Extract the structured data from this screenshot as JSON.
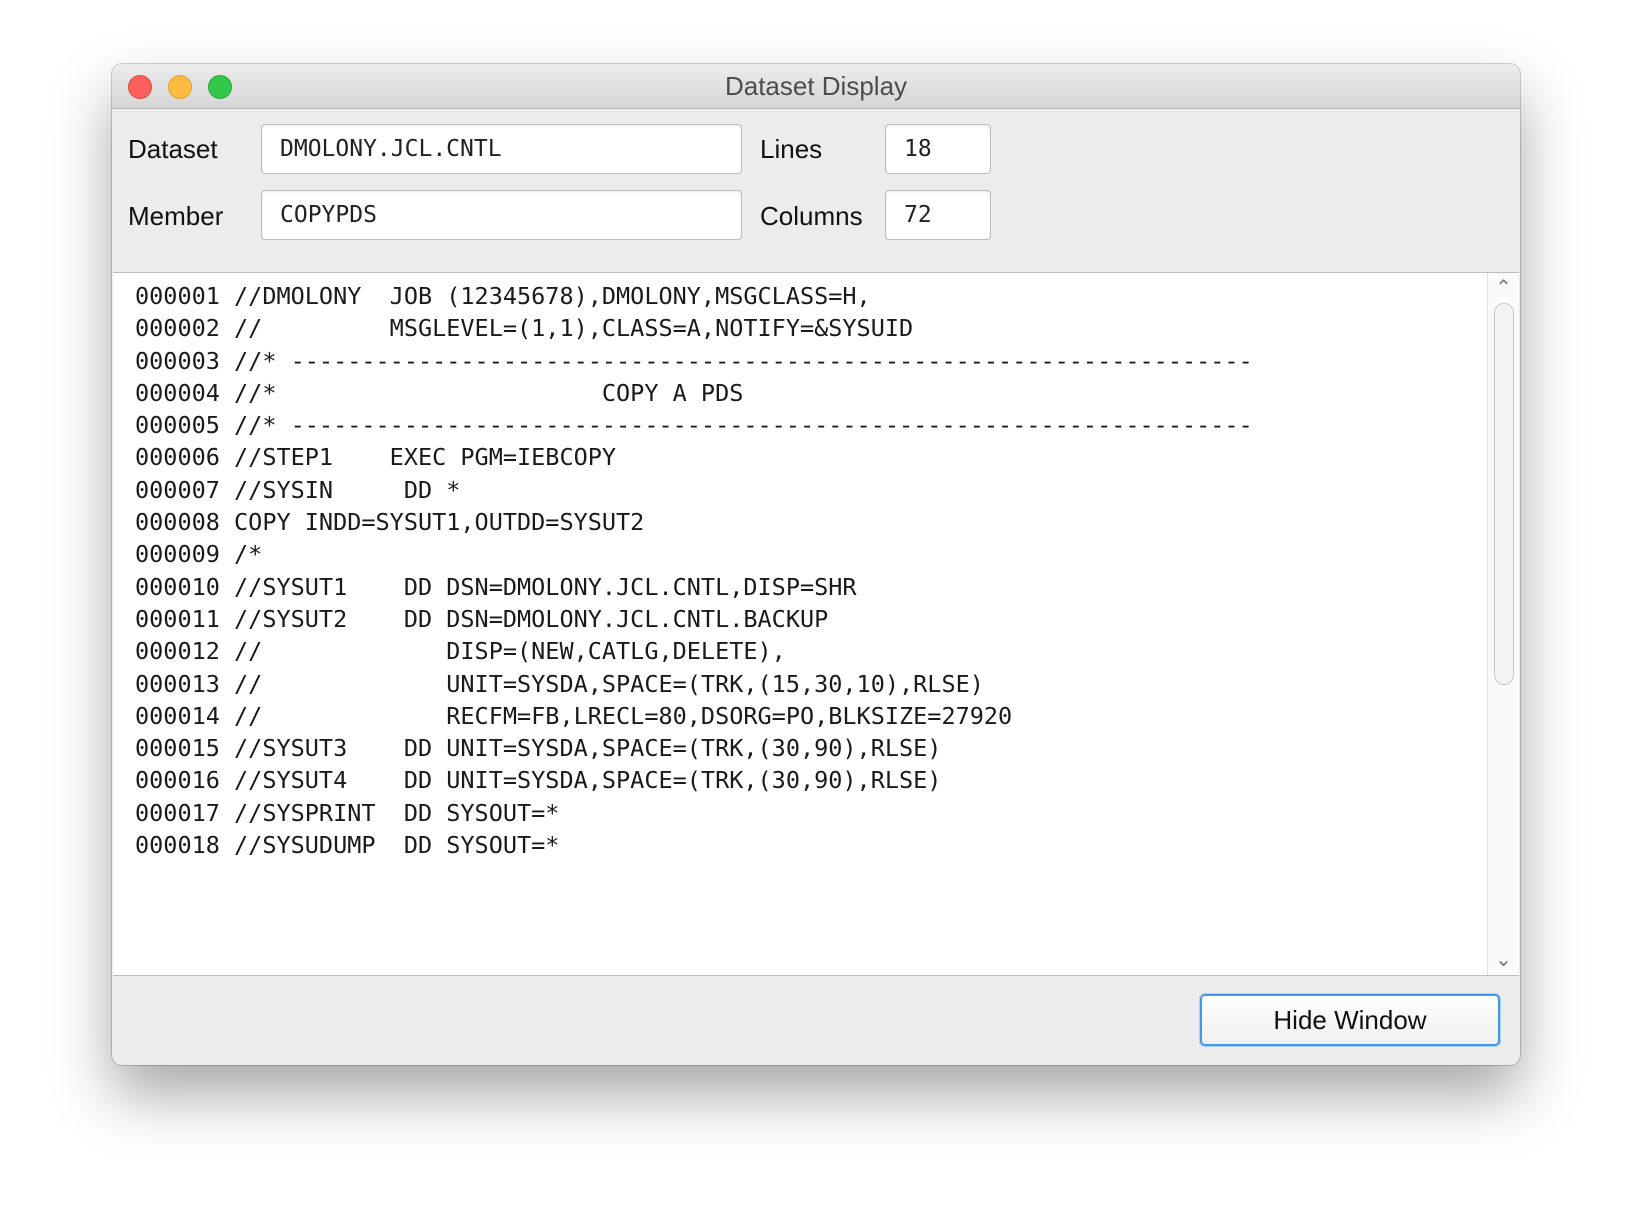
{
  "window": {
    "title": "Dataset Display"
  },
  "form": {
    "dataset_label": "Dataset",
    "dataset_value": "DMOLONY.JCL.CNTL",
    "member_label": "Member",
    "member_value": "COPYPDS",
    "lines_label": "Lines",
    "lines_value": "18",
    "columns_label": "Columns",
    "columns_value": "72"
  },
  "content": {
    "lines": [
      "000001 //DMOLONY  JOB (12345678),DMOLONY,MSGCLASS=H,",
      "000002 //         MSGLEVEL=(1,1),CLASS=A,NOTIFY=&SYSUID",
      "000003 //* --------------------------------------------------------------------",
      "000004 //*                       COPY A PDS",
      "000005 //* --------------------------------------------------------------------",
      "000006 //STEP1    EXEC PGM=IEBCOPY",
      "000007 //SYSIN     DD *",
      "000008 COPY INDD=SYSUT1,OUTDD=SYSUT2",
      "000009 /*",
      "000010 //SYSUT1    DD DSN=DMOLONY.JCL.CNTL,DISP=SHR",
      "000011 //SYSUT2    DD DSN=DMOLONY.JCL.CNTL.BACKUP",
      "000012 //             DISP=(NEW,CATLG,DELETE),",
      "000013 //             UNIT=SYSDA,SPACE=(TRK,(15,30,10),RLSE)",
      "000014 //             RECFM=FB,LRECL=80,DSORG=PO,BLKSIZE=27920",
      "000015 //SYSUT3    DD UNIT=SYSDA,SPACE=(TRK,(30,90),RLSE)",
      "000016 //SYSUT4    DD UNIT=SYSDA,SPACE=(TRK,(30,90),RLSE)",
      "000017 //SYSPRINT  DD SYSOUT=*",
      "000018 //SYSUDUMP  DD SYSOUT=*"
    ]
  },
  "footer": {
    "hide_button_label": "Hide Window"
  },
  "icons": {
    "scroll_up": "chevron-up-icon",
    "scroll_down": "chevron-down-icon"
  },
  "colors": {
    "close": "#fc605c",
    "minimize": "#fdbc40",
    "zoom": "#34c84a",
    "focus_ring": "#3d9ae8"
  }
}
